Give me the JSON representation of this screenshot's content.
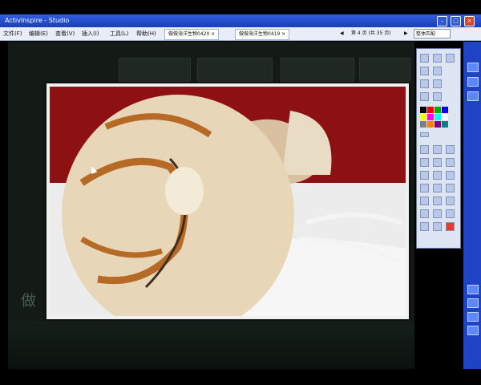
{
  "titlebar": {
    "app_name": "ActivInspire - Studio"
  },
  "menu": [
    {
      "label": "文件(F)"
    },
    {
      "label": "编辑(E)"
    },
    {
      "label": "查看(V)"
    },
    {
      "label": "插入(I)"
    },
    {
      "label": "工具(L)"
    },
    {
      "label": "帮助(H)"
    }
  ],
  "doc_tabs": [
    {
      "label": "做做海洋生物0420 ×"
    },
    {
      "label": "做做海洋生物0419 ×"
    }
  ],
  "pager": {
    "label": "第 4 页 (共 35 页)"
  },
  "zoom": {
    "label": "整体匹配"
  },
  "canvas": {
    "side_text": "做"
  },
  "toolbox": {
    "swatches": [
      "#000000",
      "#ff0000",
      "#00a000",
      "#0000ff",
      "#ffff00",
      "#ff00ff",
      "#00ffff",
      "#ffffff",
      "#808080",
      "#ff8000",
      "#800080",
      "#008080"
    ]
  },
  "colors": {
    "title_blue": "#1a3fb8",
    "photo_bg": "#8d1012",
    "canvas_bg": "#141a16"
  }
}
